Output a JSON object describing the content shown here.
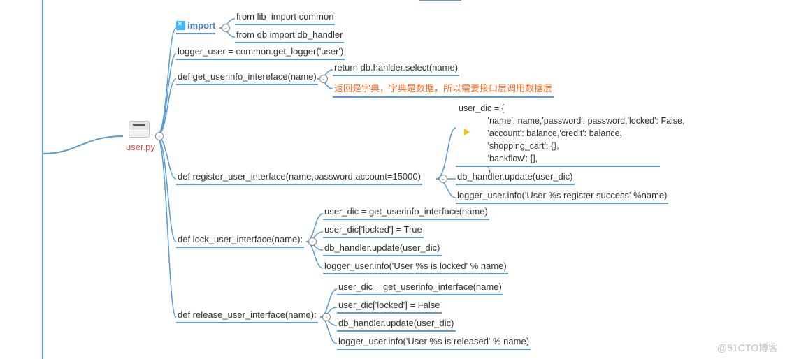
{
  "root": {
    "label": "user.py"
  },
  "import": {
    "label": "import",
    "items": [
      "from lib  import common",
      "from db import db_handler"
    ]
  },
  "logger_line": "logger_user = common.get_logger('user')",
  "get_userinfo": {
    "def": "def get_userinfo_intereface(name)",
    "ret": "return db.hanlder.select(name)",
    "note": "返回是字典，字典是数据，所以需要接口层调用数据层"
  },
  "register": {
    "def": "def register_user_interface(name,password,account=15000)",
    "dict": "user_dic = {\n            'name': name,'password': password,'locked': False,\n            'account': balance,'credit': balance,\n            'shopping_cart': {},\n            'bankflow': [],\n            }",
    "update": "db_handler.update(user_dic)",
    "log": "logger_user.info('User %s register success' %name)"
  },
  "lock": {
    "def": "def lock_user_interface(name):",
    "lines": [
      "user_dic = get_userinfo_interface(name)",
      "user_dic['locked'] = True",
      "db_handler.update(user_dic)",
      "logger_user.info('User %s is locked' % name)"
    ]
  },
  "release": {
    "def": "def release_user_interface(name):",
    "lines": [
      "user_dic = get_userinfo_interface(name)",
      "user_dic['locked'] = False",
      "db_handler.update(user_dic)",
      "logger_user.info('User %s is released' % name)"
    ]
  },
  "watermark": "@51CTO博客"
}
